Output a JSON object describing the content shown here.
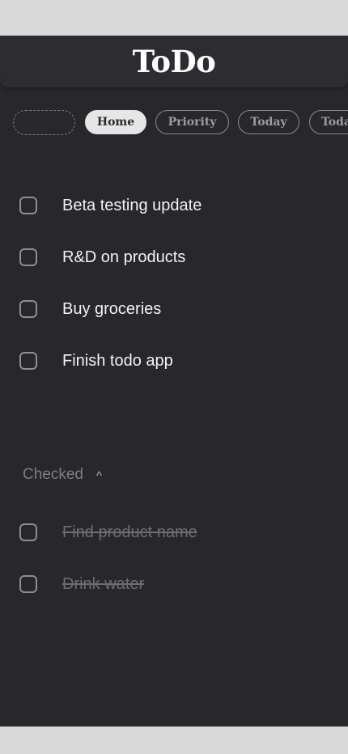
{
  "app": {
    "title": "ToDo"
  },
  "tabs": [
    {
      "label": ""
    },
    {
      "label": "Home",
      "active": true
    },
    {
      "label": "Priority"
    },
    {
      "label": "Today"
    },
    {
      "label": "Today"
    }
  ],
  "tasks": [
    {
      "label": "Beta testing update",
      "checked": false
    },
    {
      "label": "R&D on products",
      "checked": false
    },
    {
      "label": "Buy groceries",
      "checked": false
    },
    {
      "label": "Finish todo app",
      "checked": false
    }
  ],
  "checked_section": {
    "title": "Checked",
    "caret": "^",
    "items": [
      {
        "label": "Find product name",
        "checked": true
      },
      {
        "label": "Drink water",
        "checked": true
      }
    ]
  },
  "colors": {
    "background": "#27272c",
    "header": "#2c2c31",
    "active_tab": "#e6e6e6",
    "text": "#f2f2f2",
    "muted": "#6d6d72"
  }
}
